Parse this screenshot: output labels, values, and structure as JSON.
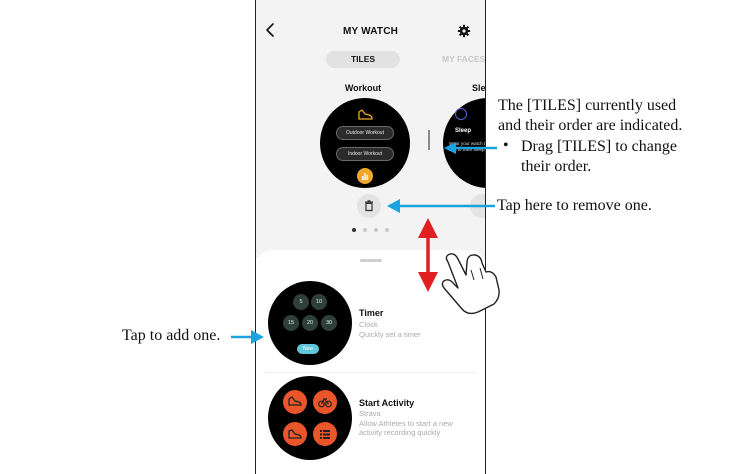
{
  "header": {
    "title": "MY WATCH"
  },
  "tabs": [
    {
      "label": "TILES",
      "active": true
    },
    {
      "label": "MY FACES",
      "active": false
    }
  ],
  "tiles": {
    "workout": {
      "title": "Workout",
      "buttons": [
        "Outdoor Workout",
        "Indoor Workout"
      ]
    },
    "sleep": {
      "title": "Sleep",
      "label": "Sleep",
      "description": "Wear your watch to bed to track sleep"
    }
  },
  "pagination": {
    "current": 1,
    "total": 4
  },
  "available_tiles": [
    {
      "title": "Timer",
      "app": "Clock",
      "description": "Quickly set a timer",
      "buttons": [
        "5",
        "10",
        "15",
        "20",
        "30"
      ],
      "badge": "New"
    },
    {
      "title": "Start Activity",
      "app": "Strava",
      "description": "Allow Athletes to start a new activity recording quickly",
      "icons": [
        "run-icon",
        "bike-icon",
        "shoe-icon",
        "list-icon"
      ]
    }
  ],
  "annotations": {
    "tiles_line1": "The [TILES] currently used",
    "tiles_line2": "and their order are indicated.",
    "bullet": "•",
    "drag_line1": "Drag [TILES] to change",
    "drag_line2": "their order.",
    "remove": "Tap here to remove one.",
    "add": "Tap to add one."
  },
  "colors": {
    "accent_orange": "#e8562a",
    "workout_yellow": "#f1a82a",
    "arrow_blue": "#1aa3e0",
    "arrow_red": "#e02020",
    "new_badge": "#5ec7da"
  }
}
